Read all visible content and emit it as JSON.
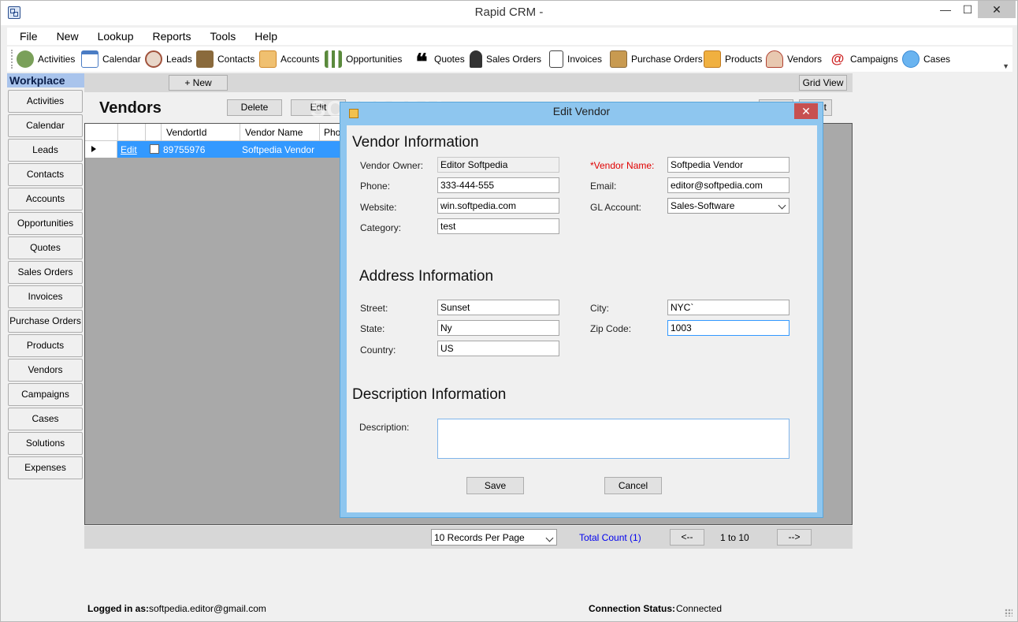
{
  "window": {
    "title": "Rapid CRM -",
    "minimize": "—",
    "maximize": "☐",
    "close": "✕"
  },
  "menu": [
    "File",
    "New",
    "Lookup",
    "Reports",
    "Tools",
    "Help"
  ],
  "toolbar": [
    {
      "label": "Activities",
      "icon": "activities-icon",
      "color": "#7aa05a"
    },
    {
      "label": "Calendar",
      "icon": "calendar-icon",
      "color": "#4a7cc4"
    },
    {
      "label": "Leads",
      "icon": "leads-icon",
      "color": "#a0523c"
    },
    {
      "label": "Contacts",
      "icon": "contacts-icon",
      "color": "#8a6a3c"
    },
    {
      "label": "Accounts",
      "icon": "accounts-icon",
      "color": "#d08a2c"
    },
    {
      "label": "Opportunities",
      "icon": "opportunities-icon",
      "color": "#5a8a3c"
    },
    {
      "label": "Quotes",
      "icon": "quotes-icon",
      "color": "#222222"
    },
    {
      "label": "Sales Orders",
      "icon": "sales-orders-icon",
      "color": "#333333"
    },
    {
      "label": "Invoices",
      "icon": "invoices-icon",
      "color": "#666666"
    },
    {
      "label": "Purchase Orders",
      "icon": "purchase-orders-icon",
      "color": "#b07a30"
    },
    {
      "label": "Products",
      "icon": "products-icon",
      "color": "#d09a30"
    },
    {
      "label": "Vendors",
      "icon": "vendors-icon",
      "color": "#b04030"
    },
    {
      "label": "Campaigns",
      "icon": "campaigns-icon",
      "color": "#cc2222"
    },
    {
      "label": "Cases",
      "icon": "cases-icon",
      "color": "#3a8ad4"
    }
  ],
  "sidebar": {
    "title": "Workplace",
    "items": [
      "Activities",
      "Calendar",
      "Leads",
      "Contacts",
      "Accounts",
      "Opportunities",
      "Quotes",
      "Sales Orders",
      "Invoices",
      "Purchase Orders",
      "Products",
      "Vendors",
      "Campaigns",
      "Cases",
      "Solutions",
      "Expenses"
    ]
  },
  "main": {
    "new_button": "+ New",
    "grid_view_button": "Grid View",
    "heading": "Vendors",
    "delete_button": "Delete",
    "edit_button": "Edit",
    "hidden_button": "t",
    "watermark": "SOFTPEDIA"
  },
  "grid": {
    "columns": [
      "VendortId",
      "Vendor Name",
      "Phon"
    ],
    "rows": [
      {
        "edit": "Edit",
        "id": "89755976",
        "name": "Softpedia Vendor"
      }
    ]
  },
  "pager": {
    "per_page": "10 Records Per Page",
    "total": "Total Count (1)",
    "prev": "<--",
    "range": "1 to 10",
    "next": "-->"
  },
  "status": {
    "logged_label": "Logged in as:",
    "logged_value": "softpedia.editor@gmail.com",
    "conn_label": "Connection Status:",
    "conn_value": "Connected"
  },
  "dialog": {
    "title": "Edit Vendor",
    "close": "✕",
    "vendor_section": "Vendor Information",
    "fields": {
      "owner_label": "Vendor Owner:",
      "owner_value": "Editor Softpedia",
      "name_label": "*Vendor Name:",
      "name_value": "Softpedia Vendor",
      "phone_label": "Phone:",
      "phone_value": "333-444-555",
      "email_label": "Email:",
      "email_value": "editor@softpedia.com",
      "website_label": "Website:",
      "website_value": "win.softpedia.com",
      "gl_label": "GL Account:",
      "gl_value": "Sales-Software",
      "category_label": "Category:",
      "category_value": "test"
    },
    "address_section": "Address Information",
    "address": {
      "street_label": "Street:",
      "street_value": "Sunset",
      "city_label": "City:",
      "city_value": "NYC`",
      "state_label": "State:",
      "state_value": "Ny",
      "zip_label": "Zip Code:",
      "zip_value": "1003",
      "country_label": "Country:",
      "country_value": "US"
    },
    "description_section": "Description Information",
    "description_label": "Description:",
    "description_value": "",
    "save": "Save",
    "cancel": "Cancel"
  }
}
